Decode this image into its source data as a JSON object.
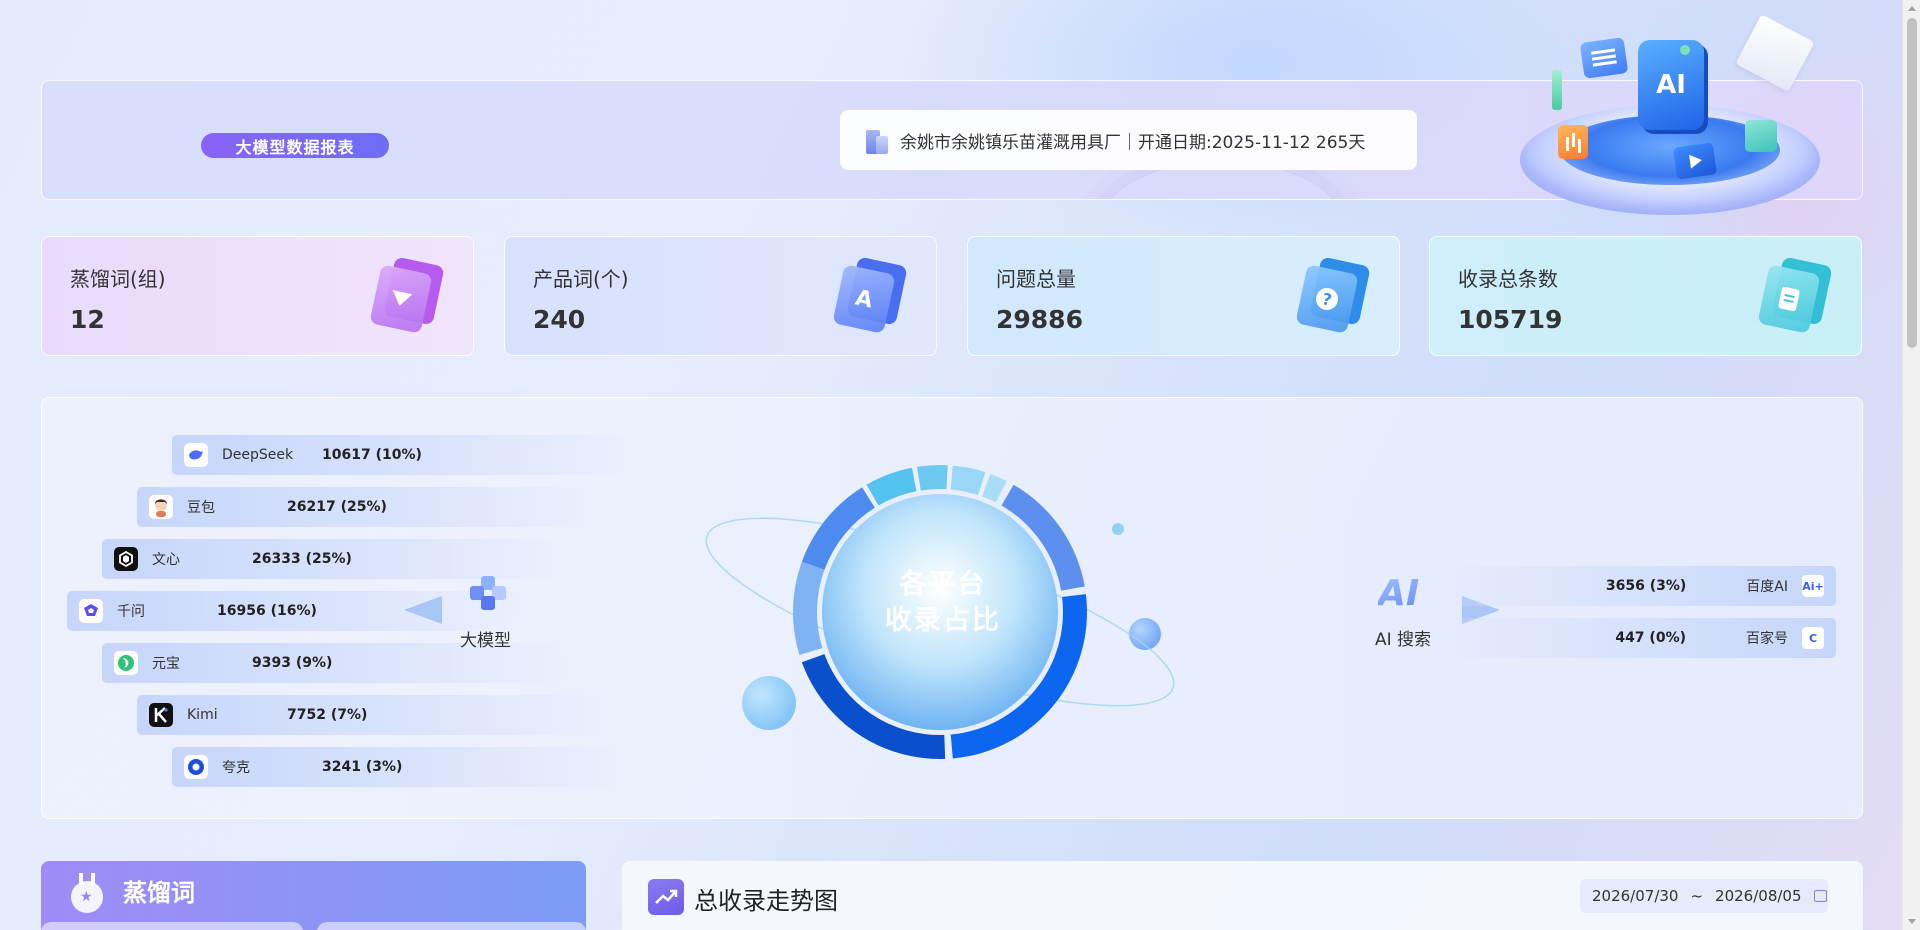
{
  "header": {
    "badge": "大模型数据报表",
    "company_info": "余姚市余姚镇乐苗灌溉用具厂｜开通日期:2025-11-12 265天"
  },
  "stats": [
    {
      "label": "蒸馏词(组)",
      "value": "12",
      "icon": "funnel-icon"
    },
    {
      "label": "产品词(个)",
      "value": "240",
      "icon": "letter-a-icon"
    },
    {
      "label": "问题总量",
      "value": "29886",
      "icon": "question-icon"
    },
    {
      "label": "收录总条数",
      "value": "105719",
      "icon": "document-icon"
    }
  ],
  "large_models": {
    "label": "大模型",
    "items": [
      {
        "name": "DeepSeek",
        "value": "10617 (10%)",
        "logo_color": "#ffffff"
      },
      {
        "name": "豆包",
        "value": "26217 (25%)",
        "logo_color": "#ffffff"
      },
      {
        "name": "文心",
        "value": "26333 (25%)",
        "logo_color": "#111111"
      },
      {
        "name": "千问",
        "value": "16956 (16%)",
        "logo_color": "#4f5af0"
      },
      {
        "name": "元宝",
        "value": "9393 (9%)",
        "logo_color": "#ffffff"
      },
      {
        "name": "Kimi",
        "value": "7752 (7%)",
        "logo_color": "#111111"
      },
      {
        "name": "夸克",
        "value": "3241 (3%)",
        "logo_color": "#ffffff"
      }
    ]
  },
  "ai_search": {
    "label": "AI 搜索",
    "icon_text": "AI",
    "items": [
      {
        "name": "百度AI",
        "value": "3656 (3%)",
        "logo_text": "Ai+"
      },
      {
        "name": "百家号",
        "value": "447 (0%)",
        "logo_text": "C"
      }
    ]
  },
  "donut": {
    "title_line1": "各平台",
    "title_line2": "收录占比",
    "colors": [
      "#55c3ef",
      "#6ec9f1",
      "#9ad6f5",
      "#a9dcf6",
      "#cfe9fb",
      "#5d90ee",
      "#0c66f0",
      "#0a4fcb",
      "#4d8bee",
      "#80b3f2",
      "#36b9ec"
    ]
  },
  "keyword_panel": {
    "title": "蒸馏词"
  },
  "trend_panel": {
    "title": "总收录走势图",
    "date_start": "2026/07/30",
    "date_sep": "~",
    "date_end": "2026/08/05"
  }
}
